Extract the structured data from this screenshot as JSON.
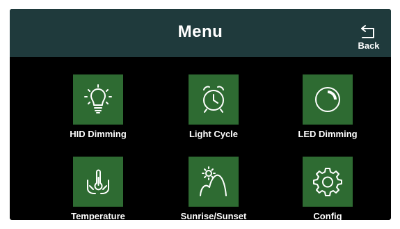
{
  "header": {
    "title": "Menu",
    "back_label": "Back"
  },
  "menu": {
    "items": [
      {
        "label": "HID Dimming",
        "icon": "bulb-icon"
      },
      {
        "label": "Light Cycle",
        "icon": "alarm-clock-icon"
      },
      {
        "label": "LED Dimming",
        "icon": "dial-gauge-icon"
      },
      {
        "label": "Temperature",
        "icon": "thermometer-hands-icon"
      },
      {
        "label": "Sunrise/Sunset",
        "icon": "sun-hills-icon"
      },
      {
        "label": "Config",
        "icon": "gear-icon"
      }
    ]
  },
  "colors": {
    "header_bg": "#1f3a3c",
    "screen_bg": "#000000",
    "tile_bg": "#2e6b32",
    "text": "#ffffff"
  }
}
